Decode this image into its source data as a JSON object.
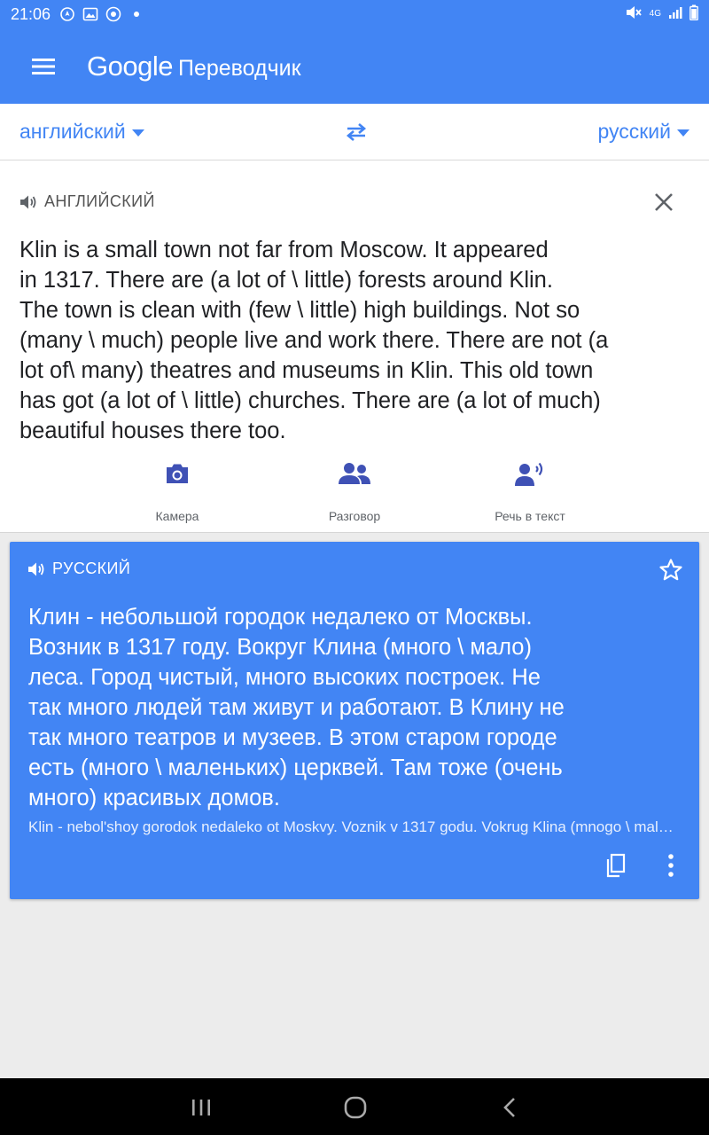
{
  "status_bar": {
    "time": "21:06",
    "network": "4G",
    "left_icons": [
      "location-icon",
      "image-icon",
      "chrome-icon",
      "dot-icon"
    ],
    "right_icons": [
      "mute-icon",
      "network-icon",
      "signal-icon",
      "battery-icon"
    ]
  },
  "app_bar": {
    "brand": "Google",
    "product": "Переводчик"
  },
  "lang_bar": {
    "source": "английский",
    "target": "русский"
  },
  "input": {
    "header": "АНГЛИЙСКИЙ",
    "text": "Klin is a small town not far from Moscow. It appeared\nin 1317. There are (a lot of \\ little) forests around Klin.\nThe town is clean with (few \\ little) high buildings. Not so\n(many \\ much) people live and work there. There are not (a\nlot of\\ many) theatres and museums in Klin. This old town\nhas got (a lot of \\ little) churches. There are (a lot of much)\nbeautiful houses there too."
  },
  "tools": {
    "camera": "Камера",
    "conversation": "Разговор",
    "transcribe": "Речь в текст"
  },
  "result": {
    "header": "РУССКИЙ",
    "text": "Клин - небольшой городок недалеко от Москвы.\nВозник в 1317 году. Вокруг Клина (много \\ мало)\nлеса.  Город чистый, много высоких построек.  Не\nтак много людей там живут и работают.  В Клину не\nтак много театров и музеев.  В этом старом городе\nесть (много \\ маленьких) церквей.  Там тоже (очень\nмного) красивых домов.",
    "transliteration": "Klin - nebol'shoy gorodok nedaleko ot Moskvy. Voznik v 1317 godu. Vokrug Klina (mnogo \\ malo) lesa."
  },
  "colors": {
    "primary": "#4285f4",
    "text": "#202124",
    "secondary_text": "#5f6368",
    "tool_icon": "#3f51b5"
  }
}
